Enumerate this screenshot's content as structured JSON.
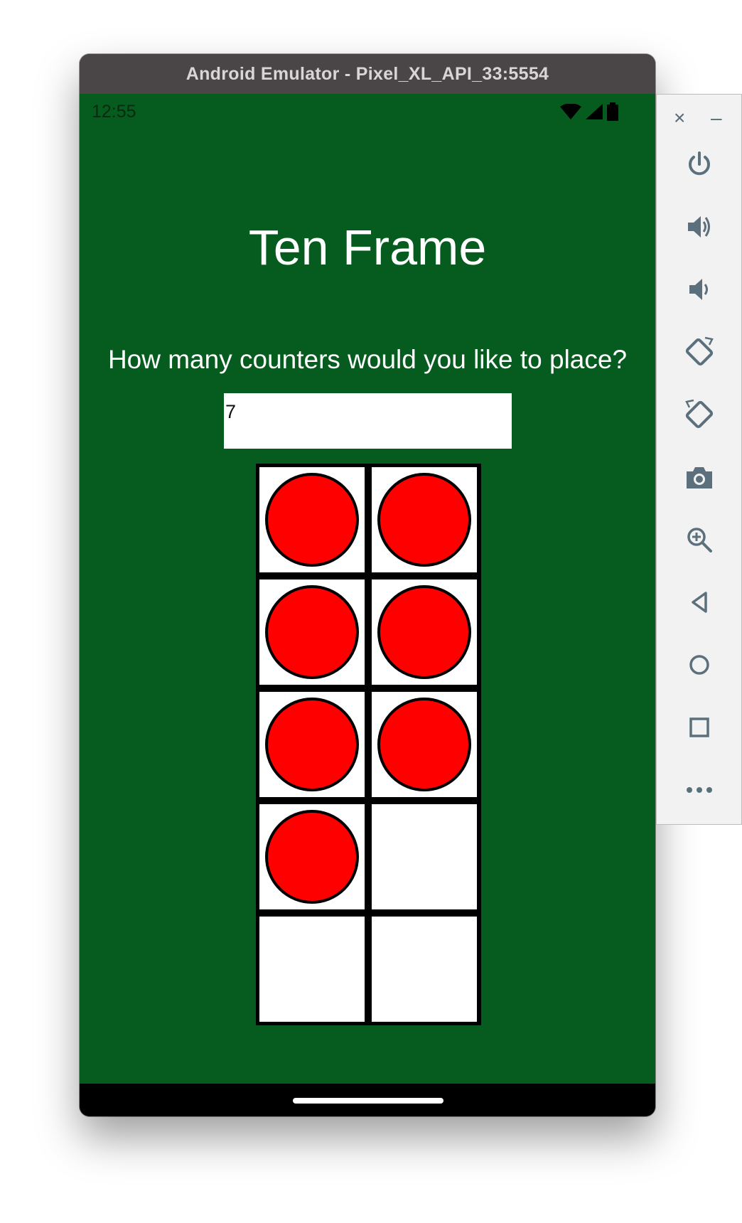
{
  "window": {
    "title": "Android Emulator - Pixel_XL_API_33:5554"
  },
  "status_bar": {
    "time": "12:55",
    "icons": [
      "wifi-icon",
      "cell-signal-icon",
      "battery-icon"
    ]
  },
  "app": {
    "title": "Ten Frame",
    "prompt": "How many counters would you like to place?",
    "input_value": "7",
    "counters_filled": 7,
    "total_cells": 10,
    "colors": {
      "background": "#065c1e",
      "counter": "#ff0000",
      "cell": "#ffffff",
      "frame": "#000000"
    }
  },
  "toolbar": {
    "close_label": "×",
    "minimize_label": "–",
    "buttons": [
      "power-icon",
      "volume-up-icon",
      "volume-down-icon",
      "rotate-left-icon",
      "rotate-right-icon",
      "camera-icon",
      "zoom-icon",
      "back-icon",
      "home-icon",
      "overview-icon",
      "more-icon"
    ]
  }
}
